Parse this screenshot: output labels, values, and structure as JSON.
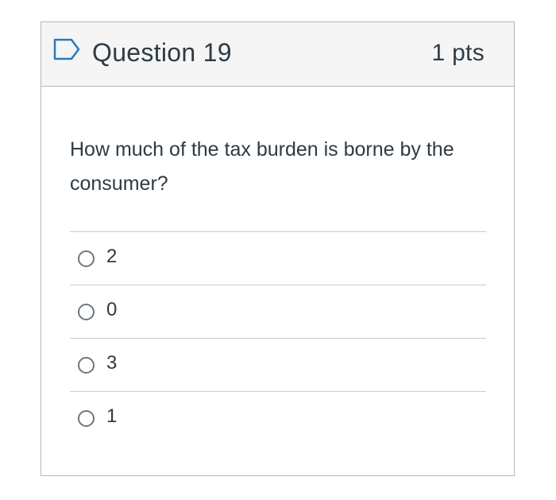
{
  "question": {
    "title": "Question 19",
    "points": "1 pts",
    "text": "How much of the tax burden is borne by the consumer?",
    "flag_icon": "flag-outline-icon",
    "answers": [
      {
        "label": "2",
        "selected": false
      },
      {
        "label": "0",
        "selected": false
      },
      {
        "label": "3",
        "selected": false
      },
      {
        "label": "1",
        "selected": false
      }
    ]
  },
  "colors": {
    "header_bg": "#f5f5f5",
    "border": "#b6b6b6",
    "text": "#2d3b45",
    "flag_stroke": "#2b7abc"
  }
}
